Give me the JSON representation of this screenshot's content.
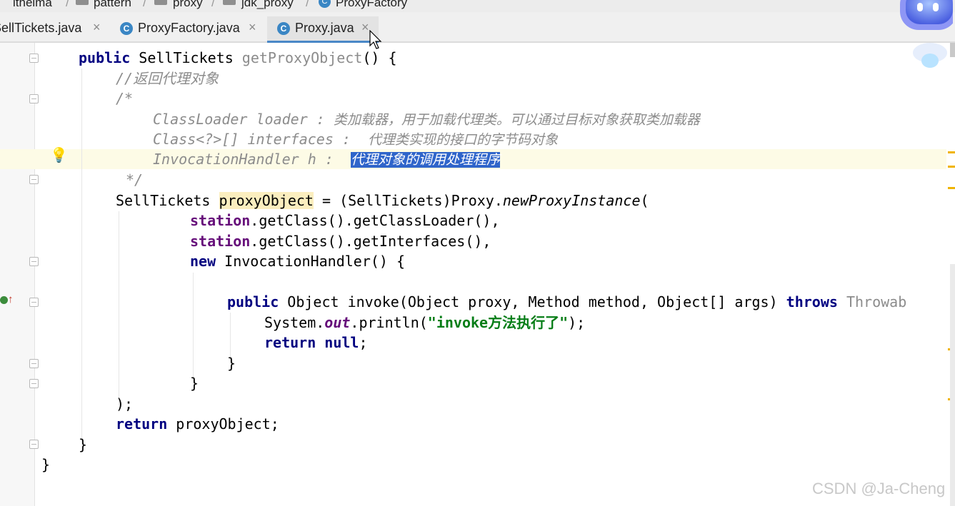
{
  "breadcrumb": {
    "items": [
      "itheima",
      "pattern",
      "proxy",
      "jdk_proxy",
      "ProxyFactory"
    ],
    "separator": "/"
  },
  "tabs": [
    {
      "label": "SellTickets.java",
      "close": "×"
    },
    {
      "label": "ProxyFactory.java",
      "close": "×",
      "icon": "C"
    },
    {
      "label": "Proxy.java",
      "close": "×",
      "icon": "C"
    }
  ],
  "code": {
    "l1_kw": "public",
    "l1_type": "SellTickets",
    "l1_method": "getProxyObject",
    "l1_tail": "() {",
    "l2": "//返回代理对象",
    "l3": "/*",
    "l4_a": "ClassLoader loader : ",
    "l4_b": "类加载器，用于加载代理类。可以通过目标对象获取类加载器",
    "l5_a": "Class<?>[] interfaces :  ",
    "l5_b": "代理类实现的接口的字节码对象",
    "l6_a": "InvocationHandler h :  ",
    "l6_sel": "代理对象的调用处理程序",
    "l7": "*/",
    "l8_type": "SellTickets ",
    "l8_var": "proxyObject",
    "l8_mid": " = (SellTickets)Proxy.",
    "l8_method": "newProxyInstance",
    "l8_tail": "(",
    "l9_field": "station",
    "l9_rest": ".getClass().getClassLoader(),",
    "l10_field": "station",
    "l10_rest": ".getClass().getInterfaces(),",
    "l11_kw": "new",
    "l11_rest": " InvocationHandler() {",
    "l13_kw": "public",
    "l13_mid": " Object invoke(Object proxy, Method method, Object[] args) ",
    "l13_kw2": "throws",
    "l13_tail": " Throwab",
    "l14_a": "System.",
    "l14_field": "out",
    "l14_b": ".println(",
    "l14_str": "\"invoke方法执行了\"",
    "l14_c": ");",
    "l15_kw": "return",
    "l15_kw2": "null",
    "l15_tail": ";",
    "l16": "}",
    "l17": "}",
    "l18": ");",
    "l19_kw": "return",
    "l19_rest": " proxyObject;",
    "l20": "}",
    "l21": "}"
  },
  "watermark": "CSDN @Ja-Cheng"
}
